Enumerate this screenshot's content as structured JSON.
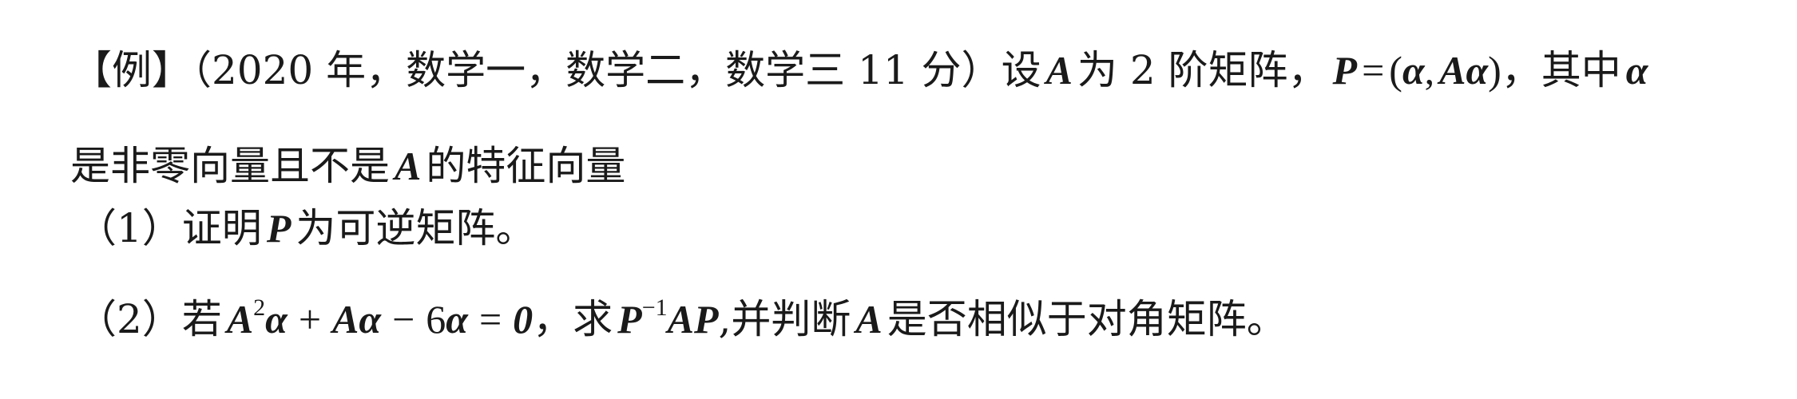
{
  "line1": {
    "tag": "【例】",
    "source": "（2020 年，数学一，数学二，数学三 11 分）",
    "set": "设",
    "A": "A",
    "is_order2": "为 2 阶矩阵，",
    "P": "P",
    "equals": "=",
    "lparen": "(",
    "alpha1": "α",
    "comma": ",",
    "A_alpha": "Aα",
    "rparen": ")",
    "where": "，其中",
    "alpha2": "α"
  },
  "line2": {
    "text_a": "是非零向量且不是",
    "A": "A",
    "text_b": "的特征向量"
  },
  "line3": {
    "num": "（1）证明",
    "P": "P",
    "text": "为可逆矩阵。"
  },
  "line4": {
    "num": "（2）若",
    "A1": "A",
    "exp2": "2",
    "alpha1": "α",
    "plus": "+",
    "A_alpha": "Aα",
    "minus": "−",
    "six": "6",
    "alpha2": "α",
    "eq": "=",
    "zero": "0",
    "ask": "，求",
    "P1": "P",
    "exp_inv": "−1",
    "AP": "AP",
    "text": ",并判断",
    "A2": "A",
    "text_end": "是否相似于对角矩阵。"
  }
}
